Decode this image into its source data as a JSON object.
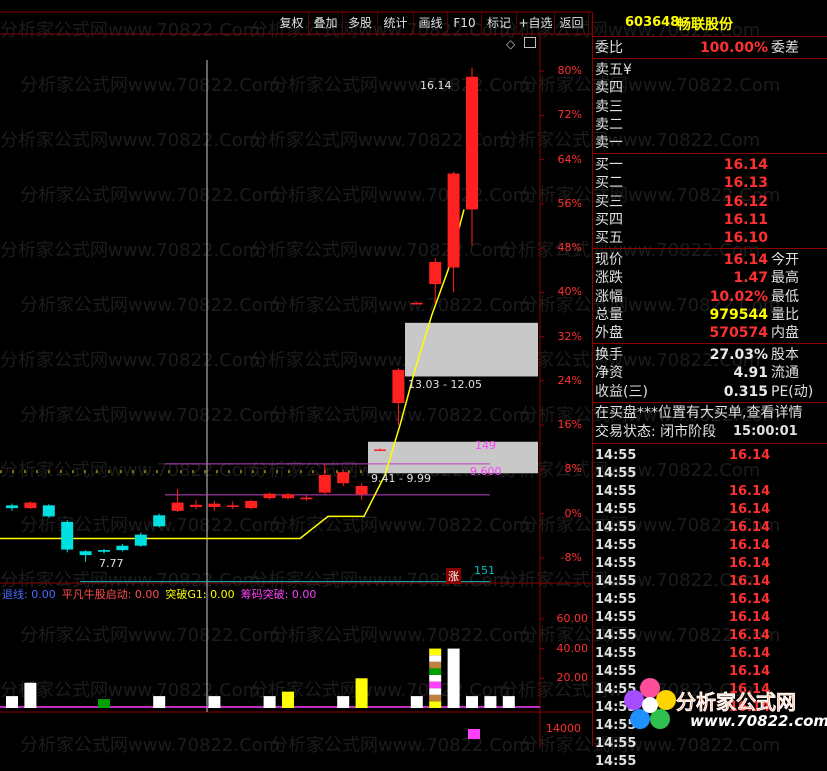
{
  "toolbar": {
    "buttons": [
      "复权",
      "叠加",
      "多股",
      "统计",
      "画线",
      "F10",
      "标记",
      "+自选",
      "返回"
    ]
  },
  "stock": {
    "code": "603648",
    "name": "畅联股份"
  },
  "chart": {
    "y_axis_labels": [
      "80%",
      "72%",
      "64%",
      "56%",
      "48%",
      "40%",
      "32%",
      "24%",
      "16%",
      "8%",
      "0%",
      "-8%"
    ],
    "annotations": {
      "high_label": "16.14",
      "low_label": "7.77",
      "gap_zone_1": "13.03 - 12.05",
      "gap_zone_2": "9.41 - 9.99",
      "level_149": "149",
      "level_9600": "9.600",
      "level_151": "151",
      "zhang_badge": "涨"
    }
  },
  "chart_data": {
    "type": "candlestick",
    "y_unit": "percent change",
    "ylim": [
      -12,
      86
    ],
    "candles": [
      {
        "open": 1.0,
        "close": 1.5,
        "high": 1.8,
        "low": 0.5,
        "color": "cyan"
      },
      {
        "open": 2.0,
        "close": 1.0,
        "high": 2.2,
        "low": 0.8,
        "color": "red"
      },
      {
        "open": 1.5,
        "close": -0.5,
        "high": 1.7,
        "low": -0.7,
        "color": "cyan"
      },
      {
        "open": -1.5,
        "close": -6.5,
        "high": -1.2,
        "low": -7.0,
        "color": "cyan"
      },
      {
        "open": -7.5,
        "close": -6.8,
        "high": -6.6,
        "low": -8.7,
        "color": "cyan"
      },
      {
        "open": -6.9,
        "close": -6.6,
        "high": -6.4,
        "low": -7.2,
        "color": "cyan"
      },
      {
        "open": -6.6,
        "close": -5.8,
        "high": -5.5,
        "low": -6.8,
        "color": "cyan"
      },
      {
        "open": -5.8,
        "close": -3.8,
        "high": -3.4,
        "low": -6.0,
        "color": "cyan"
      },
      {
        "open": -2.3,
        "close": -0.3,
        "high": 0.0,
        "low": -2.5,
        "color": "cyan"
      },
      {
        "open": 0.5,
        "close": 2.0,
        "high": 4.5,
        "low": 0.3,
        "color": "red"
      },
      {
        "open": 1.6,
        "close": 1.2,
        "high": 2.5,
        "low": 0.8,
        "color": "red"
      },
      {
        "open": 1.8,
        "close": 1.2,
        "high": 2.3,
        "low": 0.5,
        "color": "red"
      },
      {
        "open": 1.2,
        "close": 1.5,
        "high": 2.2,
        "low": 0.8,
        "color": "red"
      },
      {
        "open": 1.0,
        "close": 2.3,
        "high": 2.5,
        "low": 0.8,
        "color": "red"
      },
      {
        "open": 2.8,
        "close": 3.6,
        "high": 3.8,
        "low": 2.5,
        "color": "red"
      },
      {
        "open": 2.8,
        "close": 3.5,
        "high": 3.8,
        "low": 2.5,
        "color": "red"
      },
      {
        "open": 2.6,
        "close": 2.9,
        "high": 3.3,
        "low": 2.3,
        "color": "red"
      },
      {
        "open": 3.8,
        "close": 7.0,
        "high": 9.0,
        "low": 3.5,
        "color": "red"
      },
      {
        "open": 5.5,
        "close": 7.5,
        "high": 8.0,
        "low": 5.0,
        "color": "red"
      },
      {
        "open": 3.5,
        "close": 5.0,
        "high": 5.5,
        "low": 2.5,
        "color": "red"
      },
      {
        "open": 11.5,
        "close": 11.6,
        "high": 11.8,
        "low": 11.4,
        "color": "red"
      },
      {
        "open": 20.0,
        "close": 26.0,
        "high": 26.3,
        "low": 16.0,
        "color": "red"
      },
      {
        "open": 38.0,
        "close": 38.1,
        "high": 38.3,
        "low": 37.8,
        "color": "red"
      },
      {
        "open": 41.5,
        "close": 45.5,
        "high": 46.2,
        "low": 38.0,
        "color": "red"
      },
      {
        "open": 44.5,
        "close": 61.5,
        "high": 61.8,
        "low": 40.0,
        "color": "red"
      },
      {
        "open": 55.0,
        "close": 79.0,
        "high": 80.6,
        "low": 48.5,
        "color": "red"
      }
    ],
    "indicator": {
      "legend": [
        {
          "label": "退线: 0.00",
          "color": "#4a6aff"
        },
        {
          "label": "平凡牛股启动: 0.00",
          "color": "#ff5050"
        },
        {
          "label": "突破G1: 0.00",
          "color": "#ffff00"
        },
        {
          "label": "筹码突破: 0.00",
          "color": "#ff40ff"
        }
      ],
      "y_axis_labels": [
        "60.00",
        "40.00",
        "20.00"
      ],
      "bottom_label": "14000",
      "ylim": [
        0,
        70
      ],
      "bars": [
        8,
        17,
        0,
        0,
        0,
        6,
        0,
        0,
        8,
        0,
        0,
        8,
        0,
        0,
        8,
        11,
        0,
        0,
        8,
        20,
        0,
        0,
        8,
        40,
        40,
        8,
        8,
        8
      ],
      "bar_colors": [
        "#ffffff",
        "#ffffff",
        "#ffffff",
        "#ffffff",
        "#ffffff",
        "#00a000",
        "#ffffff",
        "#ffffff",
        "#ffffff",
        "#ffffff",
        "#ffffff",
        "#ffffff",
        "#ffffff",
        "#ffffff",
        "#ffffff",
        "#ffff00",
        "#ffffff",
        "#ffffff",
        "#ffffff",
        "#ffff00",
        "#ffffff",
        "#ffffff",
        "#ffffff",
        "#ffffff",
        "#ffffff",
        "#ffffff",
        "#ffffff",
        "#ffffff"
      ],
      "multi_bar_segments": [
        "#ffff00",
        "#c08040",
        "#ffffff",
        "#ff40ff",
        "#ffffff",
        "#00a000",
        "#c08040",
        "#ffffff",
        "#ffff00"
      ]
    }
  },
  "quote": {
    "weibi": {
      "label": "委比",
      "value": "100.00%",
      "right": "委差"
    },
    "sell": [
      {
        "label": "卖五",
        "price": "¥"
      },
      {
        "label": "卖四",
        "price": ""
      },
      {
        "label": "卖三",
        "price": ""
      },
      {
        "label": "卖二",
        "price": ""
      },
      {
        "label": "卖一",
        "price": ""
      }
    ],
    "buy": [
      {
        "label": "买一",
        "price": "16.14"
      },
      {
        "label": "买二",
        "price": "16.13"
      },
      {
        "label": "买三",
        "price": "16.12"
      },
      {
        "label": "买四",
        "price": "16.11"
      },
      {
        "label": "买五",
        "price": "16.10"
      }
    ],
    "stats": [
      {
        "label": "现价",
        "value": "16.14",
        "right": "今开",
        "cls": "red"
      },
      {
        "label": "涨跌",
        "value": "1.47",
        "right": "最高",
        "cls": "red"
      },
      {
        "label": "涨幅",
        "value": "10.02%",
        "right": "最低",
        "cls": "red"
      },
      {
        "label": "总量",
        "value": "979544",
        "right": "量比",
        "cls": "yellow"
      },
      {
        "label": "外盘",
        "value": "570574",
        "right": "内盘",
        "cls": "red"
      }
    ],
    "stats2": [
      {
        "label": "换手",
        "value": "27.03%",
        "right": "股本",
        "cls": "white"
      },
      {
        "label": "净资",
        "value": "4.91",
        "right": "流通",
        "cls": "white"
      },
      {
        "label": "收益(三)",
        "value": "0.315",
        "right": "PE(动)",
        "cls": "white"
      }
    ],
    "notice": "在买盘***位置有大买单,查看详情",
    "trade_status": {
      "label": "交易状态: 闭市阶段",
      "time": "15:00:01"
    },
    "ticks": [
      {
        "time": "14:55",
        "price": "16.14"
      },
      {
        "time": "14:55",
        "price": ""
      },
      {
        "time": "14:55",
        "price": "16.14"
      },
      {
        "time": "14:55",
        "price": "16.14"
      },
      {
        "time": "14:55",
        "price": "16.14"
      },
      {
        "time": "14:55",
        "price": "16.14"
      },
      {
        "time": "14:55",
        "price": "16.14"
      },
      {
        "time": "14:55",
        "price": "16.14"
      },
      {
        "time": "14:55",
        "price": "16.14"
      },
      {
        "time": "14:55",
        "price": "16.14"
      },
      {
        "time": "14:55",
        "price": "16.14"
      },
      {
        "time": "14:55",
        "price": "16.14"
      },
      {
        "time": "14:55",
        "price": "16.14"
      },
      {
        "time": "14:55",
        "price": "16.14"
      },
      {
        "time": "14:55",
        "price": "16.14"
      },
      {
        "time": "14:55",
        "price": ""
      },
      {
        "time": "14:55",
        "price": ""
      },
      {
        "time": "14:55",
        "price": ""
      }
    ]
  },
  "logo": {
    "main": "分析家公式网",
    "url": "www.70822.com"
  },
  "watermark": "分析家公式网www.70822.Com"
}
